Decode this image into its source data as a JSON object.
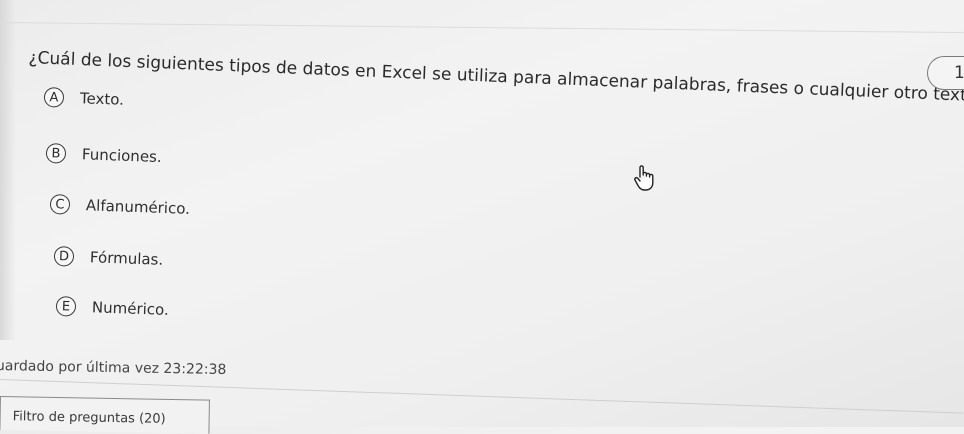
{
  "question": {
    "text": "¿Cuál de los siguientes tipos de datos en Excel se utiliza para almacenar palabras, frases o cualquier otro texto?",
    "number": "1"
  },
  "options": [
    {
      "letter": "A",
      "text": "Texto."
    },
    {
      "letter": "B",
      "text": "Funciones."
    },
    {
      "letter": "C",
      "text": "Alfanumérico."
    },
    {
      "letter": "D",
      "text": "Fórmulas."
    },
    {
      "letter": "E",
      "text": "Numérico."
    }
  ],
  "footer": {
    "saved_text": "uardado por última vez 23:22:38",
    "filter_label": "Filtro de preguntas (20)"
  },
  "icons": {
    "cursor": "hand-pointer-icon"
  }
}
